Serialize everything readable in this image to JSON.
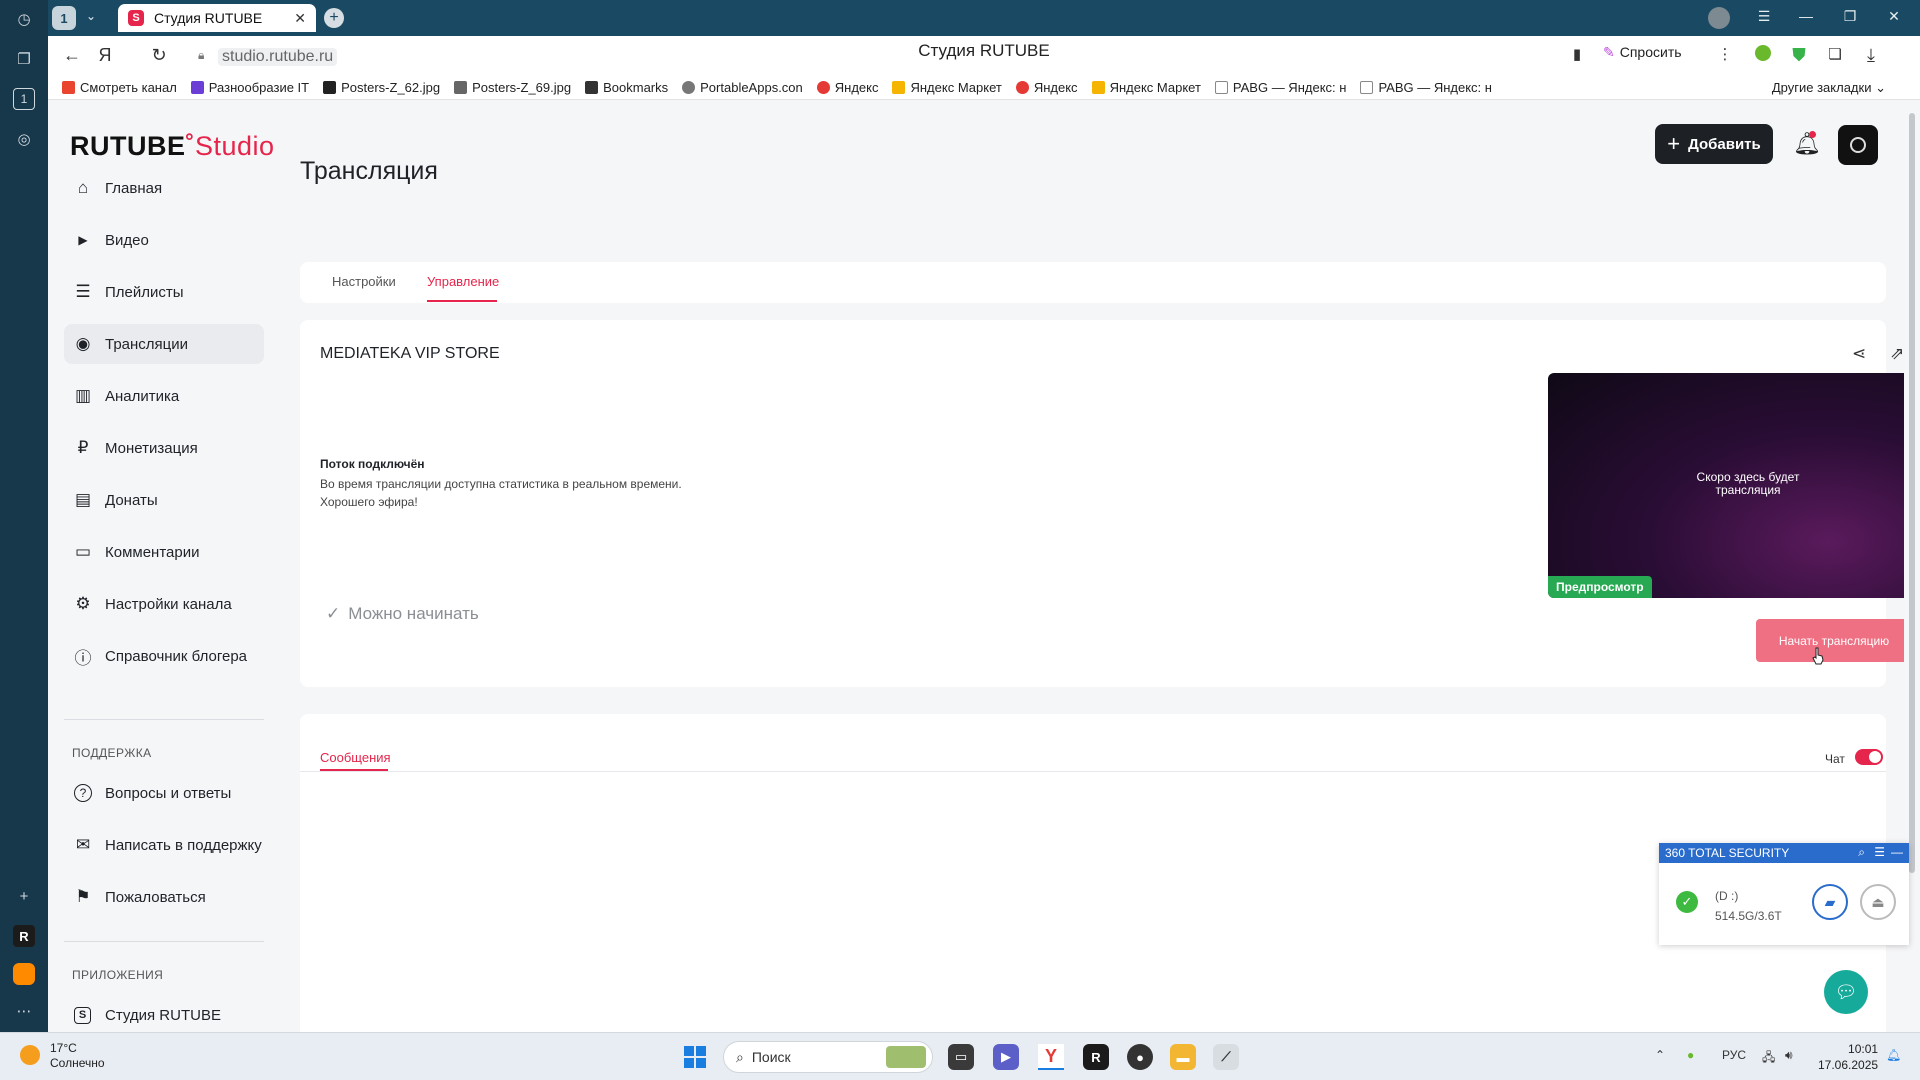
{
  "browser": {
    "tab_title": "Студия RUTUBE",
    "tab_count": "1",
    "url": "studio.rutube.ru",
    "page_title": "Студия RUTUBE",
    "ask_label": "Спросить",
    "bookmarks": [
      {
        "label": "Смотреть канал",
        "color": "#e8442e"
      },
      {
        "label": "Разнообразие IT",
        "color": "#6b3fd6"
      },
      {
        "label": "Posters-Z_62.jpg",
        "color": "#222222"
      },
      {
        "label": "Posters-Z_69.jpg",
        "color": "#666666"
      },
      {
        "label": "Bookmarks",
        "color": "#333333"
      },
      {
        "label": "PortableApps.con",
        "color": "#777777"
      },
      {
        "label": "Яндекс",
        "color": "#e53935"
      },
      {
        "label": "Яндекс Маркет",
        "color": "#f5b400"
      },
      {
        "label": "Яндекс",
        "color": "#e53935"
      },
      {
        "label": "Яндекс Маркет",
        "color": "#f5b400"
      },
      {
        "label": "PABG — Яндекс: н",
        "color": "#888888"
      },
      {
        "label": "PABG — Яндекс: н",
        "color": "#888888"
      }
    ],
    "other_bookmarks": "Другие закладки"
  },
  "studio": {
    "logo_main": "RUTUBE",
    "logo_studio": "Studio",
    "add_button": "Добавить",
    "sidebar": {
      "items": [
        {
          "label": "Главная",
          "icon": "home-icon",
          "glyph": "⌂"
        },
        {
          "label": "Видео",
          "icon": "video-icon",
          "glyph": "▶"
        },
        {
          "label": "Плейлисты",
          "icon": "playlist-icon",
          "glyph": "☰"
        },
        {
          "label": "Трансляции",
          "icon": "broadcast-icon",
          "glyph": "◉"
        },
        {
          "label": "Аналитика",
          "icon": "analytics-icon",
          "glyph": "▥"
        },
        {
          "label": "Монетизация",
          "icon": "ruble-icon",
          "glyph": "₽"
        },
        {
          "label": "Донаты",
          "icon": "wallet-icon",
          "glyph": "▤"
        },
        {
          "label": "Комментарии",
          "icon": "comment-icon",
          "glyph": "▭"
        },
        {
          "label": "Настройки канала",
          "icon": "gear-icon",
          "glyph": "⚙"
        },
        {
          "label": "Справочник блогера",
          "icon": "info-icon",
          "glyph": "ⓘ"
        }
      ],
      "support_header": "ПОДДЕРЖКА",
      "support_items": [
        {
          "label": "Вопросы и ответы",
          "icon": "question-icon",
          "glyph": "?"
        },
        {
          "label": "Написать в поддержку",
          "icon": "mail-icon",
          "glyph": "✉"
        },
        {
          "label": "Пожаловаться",
          "icon": "flag-icon",
          "glyph": "⚑"
        }
      ],
      "apps_header": "ПРИЛОЖЕНИЯ",
      "apps_items": [
        {
          "label": "Студия RUTUBE",
          "icon": "studio-app-icon",
          "glyph": "S"
        }
      ]
    },
    "page_title": "Трансляция",
    "tabs": {
      "settings": "Настройки",
      "control": "Управление"
    },
    "stream": {
      "name": "MEDIATEKA VIP STORE",
      "status_title": "Поток подключён",
      "status_line1": "Во время трансляции доступна статистика в реальном времени.",
      "status_line2": "Хорошего эфира!",
      "ready_label": "Можно начинать",
      "preview_text_line1": "Скоро здесь будет",
      "preview_text_line2": "трансляция",
      "preview_badge": "Предпросмотр",
      "start_button": "Начать трансляцию"
    },
    "chat": {
      "messages_tab": "Сообщения",
      "toggle_label": "Чат",
      "toggle_on": true
    }
  },
  "security_popup": {
    "title": "360 TOTAL SECURITY",
    "drive_label": "(D :)",
    "drive_size": "514.5G/3.6T"
  },
  "taskbar": {
    "temperature": "17°C",
    "weather": "Солнечно",
    "search_placeholder": "Поиск",
    "language": "РУС",
    "time": "10:01",
    "date": "17.06.2025"
  }
}
